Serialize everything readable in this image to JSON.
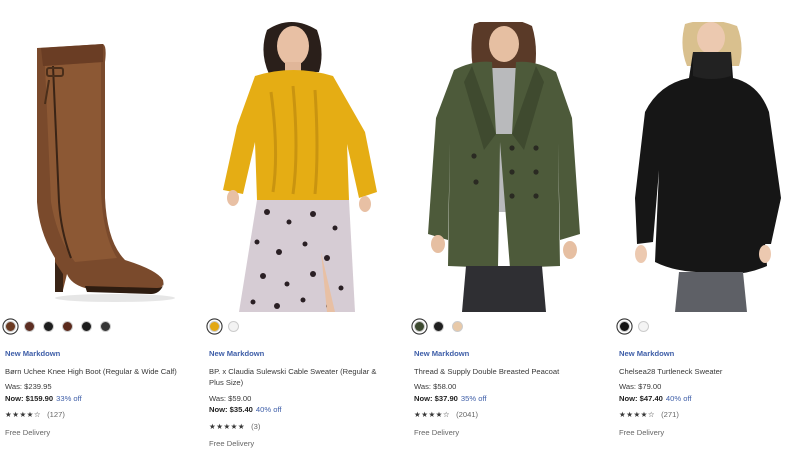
{
  "products": [
    {
      "badge": "New Markdown",
      "name": "Børn Uchee Knee High Boot (Regular & Wide Calf)",
      "was": "Was: $239.95",
      "now": "Now: $159.90",
      "discount": "33% off",
      "stars": "★★★★☆",
      "reviews": "(127)",
      "delivery": "Free Delivery",
      "swatches": [
        "#6b3a22",
        "#5c2e22",
        "#1e1e1e",
        "#5b2a1c",
        "#1c1c1c",
        "#343434"
      ]
    },
    {
      "badge": "New Markdown",
      "name": "BP. x Claudia Sulewski Cable Sweater (Regular & Plus Size)",
      "was": "Was: $59.00",
      "now": "Now: $35.40",
      "discount": "40% off",
      "stars": "★★★★★",
      "reviews": "(3)",
      "delivery": "Free Delivery",
      "swatches": [
        "#e3a814",
        "#f3f3f3"
      ]
    },
    {
      "badge": "New Markdown",
      "name": "Thread & Supply Double Breasted Peacoat",
      "was": "Was: $58.00",
      "now": "Now: $37.90",
      "discount": "35% off",
      "stars": "★★★★☆",
      "reviews": "(2041)",
      "delivery": "Free Delivery",
      "swatches": [
        "#3d4a30",
        "#1f1f1f",
        "#e8c9a8"
      ]
    },
    {
      "badge": "New Markdown",
      "name": "Chelsea28 Turtleneck Sweater",
      "was": "Was: $79.00",
      "now": "Now: $47.40",
      "discount": "40% off",
      "stars": "★★★★☆",
      "reviews": "(271)",
      "delivery": "Free Delivery",
      "swatches": [
        "#141414",
        "#f4f4f4"
      ]
    }
  ]
}
